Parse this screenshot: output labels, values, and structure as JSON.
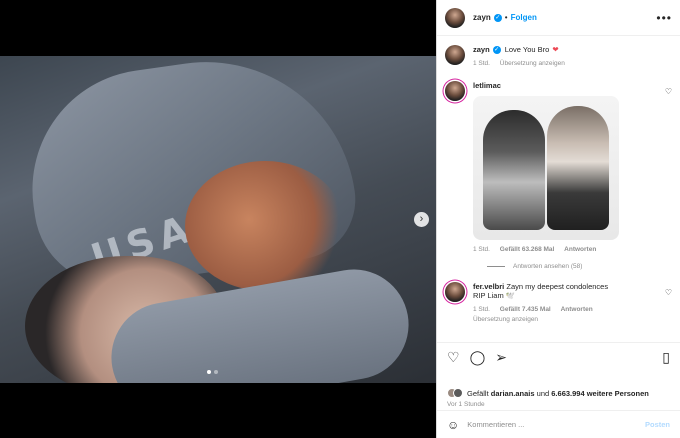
{
  "header": {
    "username": "zayn",
    "follow_label": "Folgen",
    "more_icon": "more-horizontal-icon"
  },
  "caption": {
    "username": "zayn",
    "text": "Love You Bro",
    "time": "1 Std.",
    "translate": "Übersetzung anzeigen"
  },
  "comments": [
    {
      "username": "letlimac",
      "time": "1 Std.",
      "likes": "Gefällt 63.268 Mal",
      "reply": "Antworten",
      "view_replies": "Antworten ansehen (58)"
    },
    {
      "username": "fer.velbri",
      "text": "Zayn my deepest condolences",
      "text2": "RIP Liam 🕊️",
      "time": "1 Std.",
      "likes": "Gefällt 7.435 Mal",
      "reply": "Antworten",
      "translate": "Übersetzung anzeigen"
    }
  ],
  "likes_line": {
    "prefix": "Gefällt",
    "user": "darian.anais",
    "connector": "und",
    "others": "6.663.994 weitere Personen"
  },
  "post_time": "Vor 1 Stunde",
  "composer": {
    "placeholder": "Kommentieren ...",
    "post_label": "Posten"
  },
  "icons": {
    "verified": "verified-badge-icon",
    "heart": "heart-icon",
    "comment": "comment-icon",
    "share": "share-icon",
    "save": "bookmark-icon",
    "emoji": "emoji-icon",
    "next": "chevron-right-icon"
  },
  "colors": {
    "accent": "#0095f6",
    "heart_red": "#ed4956",
    "muted": "#8e8e8e"
  }
}
